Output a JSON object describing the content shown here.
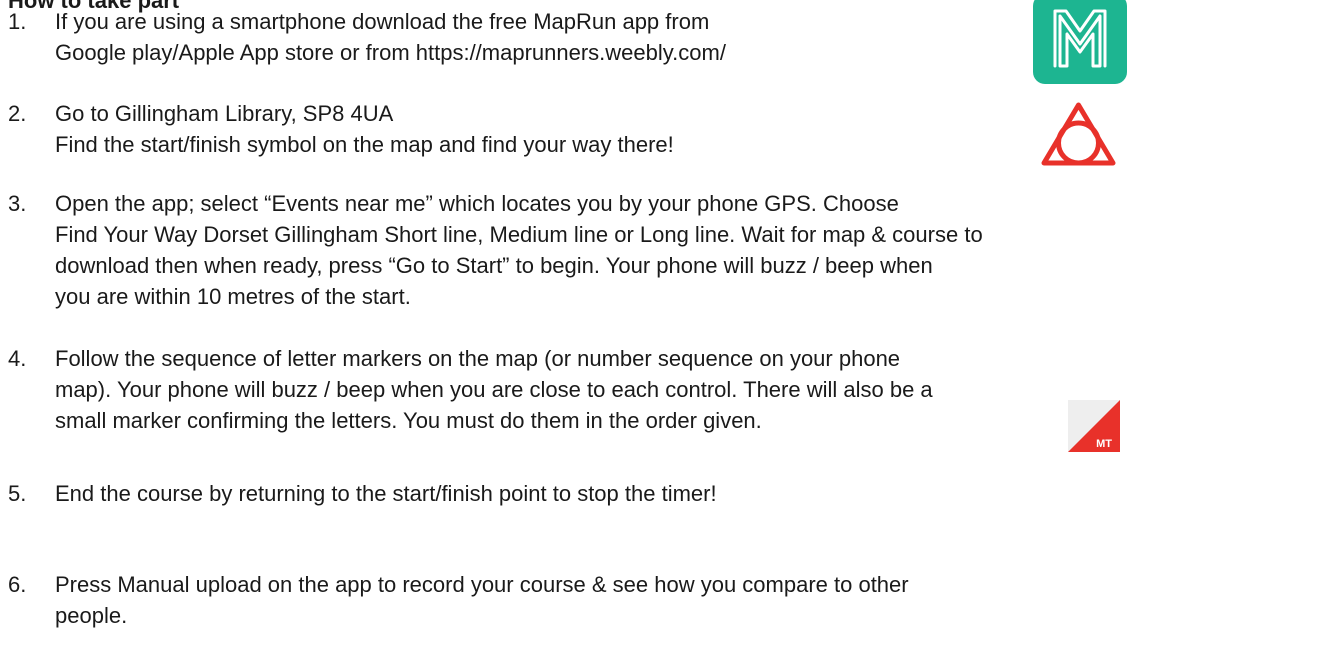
{
  "heading": "How to take part",
  "steps": [
    {
      "number": "1.",
      "lines": [
        "If you are using a smartphone download the free MapRun app from",
        "Google play/Apple App store or from https://maprunners.weebly.com/"
      ]
    },
    {
      "number": "2.",
      "lines": [
        "Go to Gillingham Library, SP8 4UA",
        "Find the start/finish symbol on the map and find your way there!"
      ]
    },
    {
      "number": "3.",
      "lines": [
        "Open the app; select “Events near me” which locates you by your phone GPS. Choose",
        "Find Your Way Dorset  Gillingham Short line, Medium line or Long line. Wait for map & course to",
        "download then when ready, press “Go to Start” to begin. Your phone will buzz / beep when",
        "you are within 10 metres of the start."
      ]
    },
    {
      "number": "4.",
      "lines": [
        "Follow the sequence of letter markers on the map (or number sequence on your phone",
        "map). Your phone will buzz / beep when you are close to each control. There will also be a",
        "small marker confirming the letters. You must do them in the order given."
      ]
    },
    {
      "number": "5.",
      "lines": [
        "End the course by returning to the start/finish point to stop the timer!"
      ]
    },
    {
      "number": "6.",
      "lines": [
        "Press Manual upload on the app to record your course & see how you compare to other",
        "people."
      ]
    }
  ],
  "icons": {
    "app": {
      "name": "maprun-app-icon",
      "bg_color": "#1db591",
      "glyph_color": "#ffffff"
    },
    "start_finish": {
      "name": "start-finish-symbol-icon",
      "color": "#e8312a"
    },
    "marker": {
      "name": "control-marker-icon",
      "label": "MT",
      "red": "#e8312a",
      "white": "#eeeeee"
    }
  }
}
